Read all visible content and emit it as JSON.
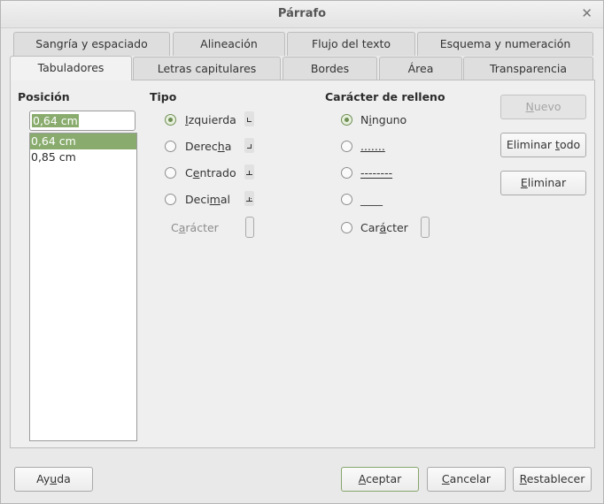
{
  "title": "Párrafo",
  "tabs_row1": [
    "Sangría y espaciado",
    "Alineación",
    "Flujo del texto",
    "Esquema y numeración"
  ],
  "tabs_row2": [
    "Tabuladores",
    "Letras capitulares",
    "Bordes",
    "Área",
    "Transparencia"
  ],
  "position": {
    "heading": "Posición",
    "value": "0,64 cm",
    "list": [
      "0,64 cm",
      "0,85 cm"
    ]
  },
  "type": {
    "heading": "Tipo",
    "options": [
      "Izquierda",
      "Derecha",
      "Centrado",
      "Decimal"
    ],
    "character_label": "Carácter"
  },
  "fill": {
    "heading": "Carácter de relleno",
    "options": [
      "Ninguno",
      ".......",
      "--------",
      "____",
      "Carácter"
    ]
  },
  "buttons": {
    "new": "Nuevo",
    "delete_all": "Eliminar todo",
    "delete": "Eliminar",
    "help": "Ayuda",
    "ok": "Aceptar",
    "cancel": "Cancelar",
    "reset": "Restablecer"
  }
}
